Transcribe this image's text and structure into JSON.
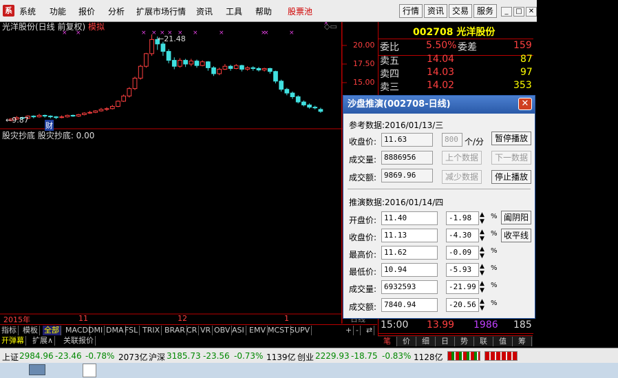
{
  "menu": {
    "logo": "系",
    "items": [
      "系统",
      "功能",
      "报价",
      "分析",
      "扩展市场行情",
      "资讯",
      "工具",
      "帮助",
      "股票池"
    ],
    "right_buttons": [
      "行情",
      "资讯",
      "交易",
      "服务"
    ],
    "win": [
      "_",
      "□",
      "✕"
    ]
  },
  "chart": {
    "title": "光洋股份(日线 前复权)",
    "mode": "模拟",
    "high_label": "21.48",
    "low_label": "9.87",
    "cai": "财",
    "indicator": "股灾抄底  股灾抄底: 0.00",
    "y_ticks": [
      "20.00",
      "17.50",
      "15.00"
    ],
    "x_labels": [
      "2015年",
      "11",
      "12",
      "1"
    ],
    "candles": [
      [
        9.9,
        10.1,
        9.8,
        10.2
      ],
      [
        10.1,
        10.3,
        10.0,
        10.5
      ],
      [
        10.3,
        10.2,
        10.0,
        10.4
      ],
      [
        10.2,
        10.5,
        10.1,
        10.6
      ],
      [
        10.5,
        10.4,
        10.2,
        10.6
      ],
      [
        10.4,
        10.6,
        10.3,
        10.8
      ],
      [
        10.6,
        10.5,
        10.3,
        10.7
      ],
      [
        10.5,
        10.4,
        10.2,
        10.6
      ],
      [
        10.4,
        10.3,
        10.1,
        10.5
      ],
      [
        10.3,
        10.4,
        10.2,
        10.6
      ],
      [
        10.4,
        10.6,
        10.3,
        10.7
      ],
      [
        10.6,
        10.5,
        10.4,
        10.7
      ],
      [
        10.5,
        10.7,
        10.4,
        10.8
      ],
      [
        10.7,
        10.9,
        10.6,
        11.0
      ],
      [
        10.9,
        11.0,
        10.8,
        11.2
      ],
      [
        11.0,
        11.2,
        10.9,
        11.3
      ],
      [
        11.2,
        11.4,
        11.1,
        11.6
      ],
      [
        11.4,
        11.5,
        11.2,
        11.7
      ],
      [
        11.5,
        11.8,
        11.4,
        12.0
      ],
      [
        11.8,
        12.5,
        11.7,
        12.6
      ],
      [
        12.5,
        13.2,
        12.4,
        13.4
      ],
      [
        13.2,
        14.2,
        13.0,
        14.4
      ],
      [
        14.2,
        15.6,
        14.0,
        15.8
      ],
      [
        15.6,
        17.2,
        15.4,
        17.4
      ],
      [
        17.2,
        18.9,
        17.0,
        19.0
      ],
      [
        18.9,
        20.8,
        18.6,
        21.48
      ],
      [
        20.8,
        20.2,
        19.4,
        21.2
      ],
      [
        20.2,
        19.2,
        18.6,
        20.5
      ],
      [
        19.2,
        18.0,
        17.6,
        19.5
      ],
      [
        18.0,
        17.2,
        16.8,
        18.4
      ],
      [
        17.2,
        18.0,
        17.0,
        18.3
      ],
      [
        18.0,
        17.5,
        17.1,
        18.2
      ],
      [
        17.5,
        17.9,
        17.2,
        18.2
      ],
      [
        17.9,
        17.3,
        17.0,
        18.1
      ],
      [
        17.3,
        17.8,
        17.2,
        18.0
      ],
      [
        17.8,
        17.0,
        16.6,
        17.9
      ],
      [
        17.0,
        16.2,
        15.9,
        17.2
      ],
      [
        16.2,
        16.8,
        16.0,
        17.0
      ],
      [
        16.8,
        17.2,
        16.7,
        17.5
      ],
      [
        17.2,
        16.9,
        16.6,
        17.4
      ],
      [
        16.9,
        17.3,
        16.8,
        17.5
      ],
      [
        17.3,
        16.8,
        16.5,
        17.4
      ],
      [
        16.8,
        17.0,
        16.6,
        17.2
      ],
      [
        17.0,
        16.9,
        16.6,
        17.2
      ],
      [
        16.9,
        16.7,
        16.5,
        17.1
      ],
      [
        16.7,
        16.9,
        16.5,
        17.0
      ],
      [
        16.9,
        16.5,
        16.2,
        17.0
      ],
      [
        16.5,
        15.2,
        14.9,
        16.6
      ],
      [
        15.2,
        14.1,
        13.8,
        15.4
      ],
      [
        14.1,
        13.6,
        13.3,
        14.3
      ],
      [
        13.6,
        13.1,
        12.8,
        13.8
      ],
      [
        13.1,
        12.4,
        12.2,
        13.3
      ],
      [
        12.4,
        12.0,
        11.8,
        12.6
      ],
      [
        12.0,
        11.7,
        11.5,
        12.2
      ],
      [
        11.7,
        11.6,
        11.4,
        11.9
      ],
      [
        11.4,
        11.13,
        10.94,
        11.62
      ]
    ]
  },
  "panel": {
    "code": "002708",
    "name": "光洋股份",
    "wb_label": "委比",
    "wb_value": "5.50%",
    "wc_label": "委差",
    "wc_value": "159",
    "asks": [
      {
        "label": "卖五",
        "price": "14.04",
        "vol": "87"
      },
      {
        "label": "卖四",
        "price": "14.03",
        "vol": "97"
      },
      {
        "label": "卖三",
        "price": "14.02",
        "vol": "353"
      }
    ],
    "time": "15:00",
    "last_price": "13.99",
    "last_vol": "1986",
    "last_cnt": "185",
    "field_label": "日线"
  },
  "tabs1": [
    "指标",
    "模板",
    "全部",
    "MACD",
    "DMI",
    "DMA",
    "FSL",
    "TRIX",
    "BRAR",
    "CR",
    "VR",
    "OBV",
    "ASI",
    "EMV",
    "MCST",
    "SUPV"
  ],
  "tabs1_ctrl": [
    "+",
    "-",
    "⇄"
  ],
  "tabs2": [
    "开弹幕",
    "扩展∧",
    "关联报价"
  ],
  "right_tabs": [
    "笔",
    "价",
    "细",
    "日",
    "势",
    "联",
    "值",
    "筹"
  ],
  "status": {
    "sh_label": "上证",
    "sh_val": "2984.96",
    "sh_chg": "-23.46",
    "sh_pct": "-0.78%",
    "sh_amt": "2073亿",
    "hs_label": "沪深",
    "hs_val": "3185.73",
    "hs_chg": "-23.56",
    "hs_pct": "-0.73%",
    "hs_amt": "1139亿",
    "cy_label": "创业",
    "cy_val": "2229.93",
    "cy_chg": "-18.75",
    "cy_pct": "-0.83%",
    "cy_amt": "1128亿"
  },
  "dialog": {
    "title": "沙盘推演(002708-日线)",
    "close": "✕",
    "ref_label": "参考数据:2016/01/13/三",
    "close_label": "收盘价:",
    "close_val": "11.63",
    "speed_val": "800",
    "speed_unit": "个/分",
    "pause_btn": "暂停播放",
    "vol_label": "成交量:",
    "vol_val": "8886956",
    "prev_btn": "上个数据",
    "next_btn": "下一数据",
    "amt_label": "成交额:",
    "amt_val": "9869.96",
    "slow_btn": "减少数据",
    "stop_btn": "停止播放",
    "sim_label": "推演数据:2016/01/14/四",
    "rows": [
      {
        "label": "开盘价:",
        "val": "11.40",
        "pct": "-1.98"
      },
      {
        "label": "收盘价:",
        "val": "11.13",
        "pct": "-4.30"
      },
      {
        "label": "最高价:",
        "val": "11.62",
        "pct": "-0.09"
      },
      {
        "label": "最低价:",
        "val": "10.94",
        "pct": "-5.93"
      },
      {
        "label": "成交量:",
        "val": "6932593",
        "pct": "-21.99"
      },
      {
        "label": "成交额:",
        "val": "7840.94",
        "pct": "-20.56"
      }
    ],
    "pct_sign": "%",
    "yy_btn": "阖阴阳",
    "flat_btn": "收平线"
  }
}
